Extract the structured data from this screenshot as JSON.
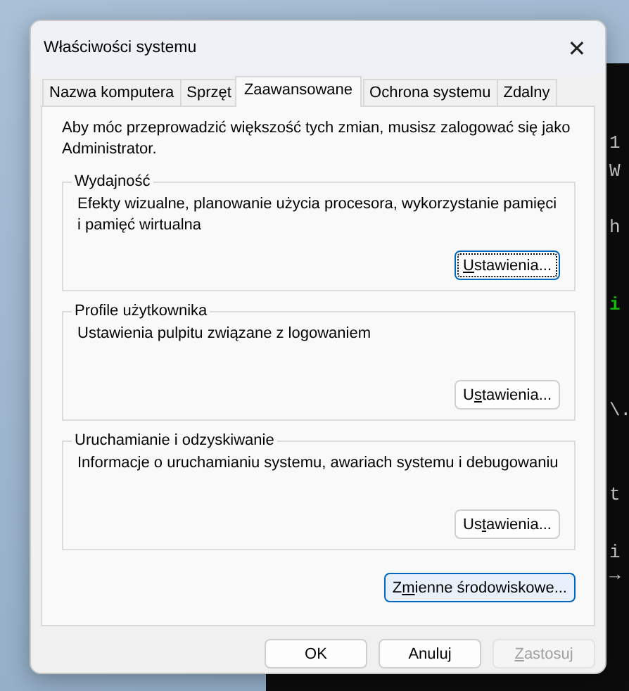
{
  "terminal": {
    "lines": [
      {
        "text": "1",
        "kind": "plain"
      },
      {
        "text": "W",
        "kind": "plain"
      },
      {
        "text": "h",
        "kind": "plain"
      },
      {
        "text": "i",
        "kind": "green"
      },
      {
        "text": "\\.",
        "kind": "plain"
      },
      {
        "text": "t",
        "kind": "plain"
      },
      {
        "text": "i",
        "kind": "plain"
      },
      {
        "text": "→",
        "kind": "plain"
      }
    ]
  },
  "window": {
    "title": "Właściwości systemu",
    "close": "✕"
  },
  "tabs": [
    {
      "label": "Nazwa komputera",
      "selected": false
    },
    {
      "label": "Sprzęt",
      "selected": false
    },
    {
      "label": "Zaawansowane",
      "selected": true
    },
    {
      "label": "Ochrona systemu",
      "selected": false
    },
    {
      "label": "Zdalny",
      "selected": false
    }
  ],
  "notice": "Aby móc przeprowadzić większość tych zmian, musisz zalogować się jako Administrator.",
  "groups": [
    {
      "title": "Wydajność",
      "description": "Efekty wizualne, planowanie użycia procesora, wykorzystanie pamięci i pamięć wirtualna",
      "button": {
        "key": "U",
        "after": "stawienia...",
        "focused": true
      }
    },
    {
      "title": "Profile użytkownika",
      "description": "Ustawienia pulpitu związane z logowaniem",
      "button": {
        "before": "U",
        "key": "s",
        "after": "tawienia...",
        "focused": false
      }
    },
    {
      "title": "Uruchamianie i odzyskiwanie",
      "description": "Informacje o uruchamianiu systemu, awariach systemu i debugowaniu",
      "button": {
        "before": "Us",
        "key": "t",
        "after": "awienia...",
        "focused": false
      }
    }
  ],
  "env_button": {
    "before": "Z",
    "key": "m",
    "after": "ienne środowiskowe...",
    "default": true
  },
  "buttons": [
    {
      "after": "OK",
      "disabled": false
    },
    {
      "after": "Anuluj",
      "disabled": false
    },
    {
      "key": "Z",
      "after": "astosuj",
      "disabled": true
    }
  ]
}
